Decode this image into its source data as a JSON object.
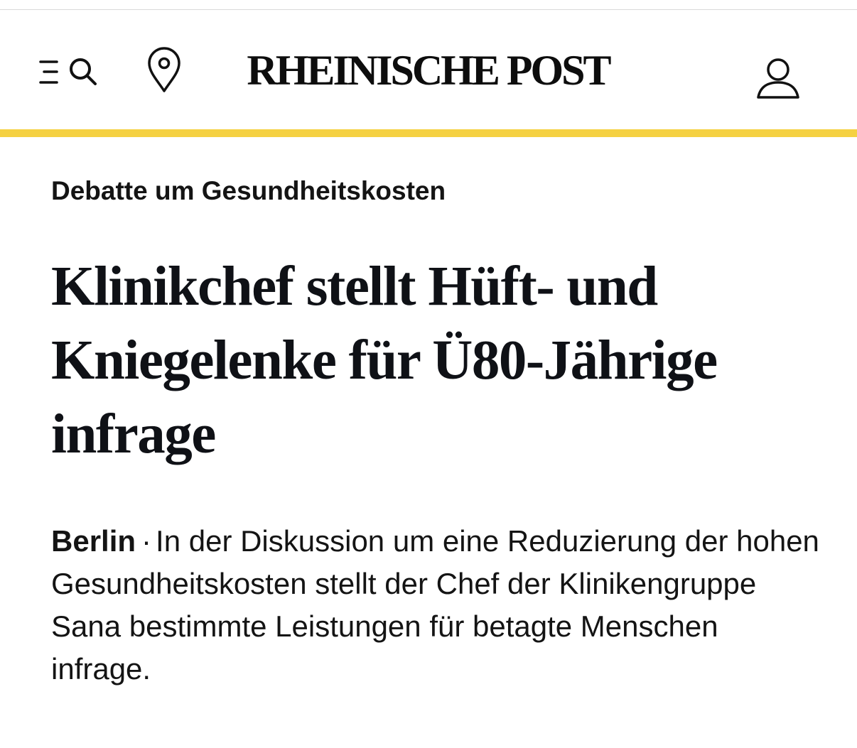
{
  "header": {
    "logo": "RHEINISCHE POST",
    "accent_color": "#f5d142",
    "icons": {
      "menu": "menu-icon",
      "search": "search-icon",
      "location": "location-pin-icon",
      "account": "user-account-icon"
    }
  },
  "article": {
    "kicker": "Debatte um Gesundheitskosten",
    "headline": "Klinikchef stellt Hüft- und Kniegelenke für Ü80-Jährige infrage",
    "dateline": "Berlin",
    "separator": "·",
    "teaser": "In der Diskussion um eine Reduzierung der hohen Gesundheitskosten stellt der Chef der Klinikengruppe Sana bestimmte Leistungen für betagte Menschen infrage."
  }
}
